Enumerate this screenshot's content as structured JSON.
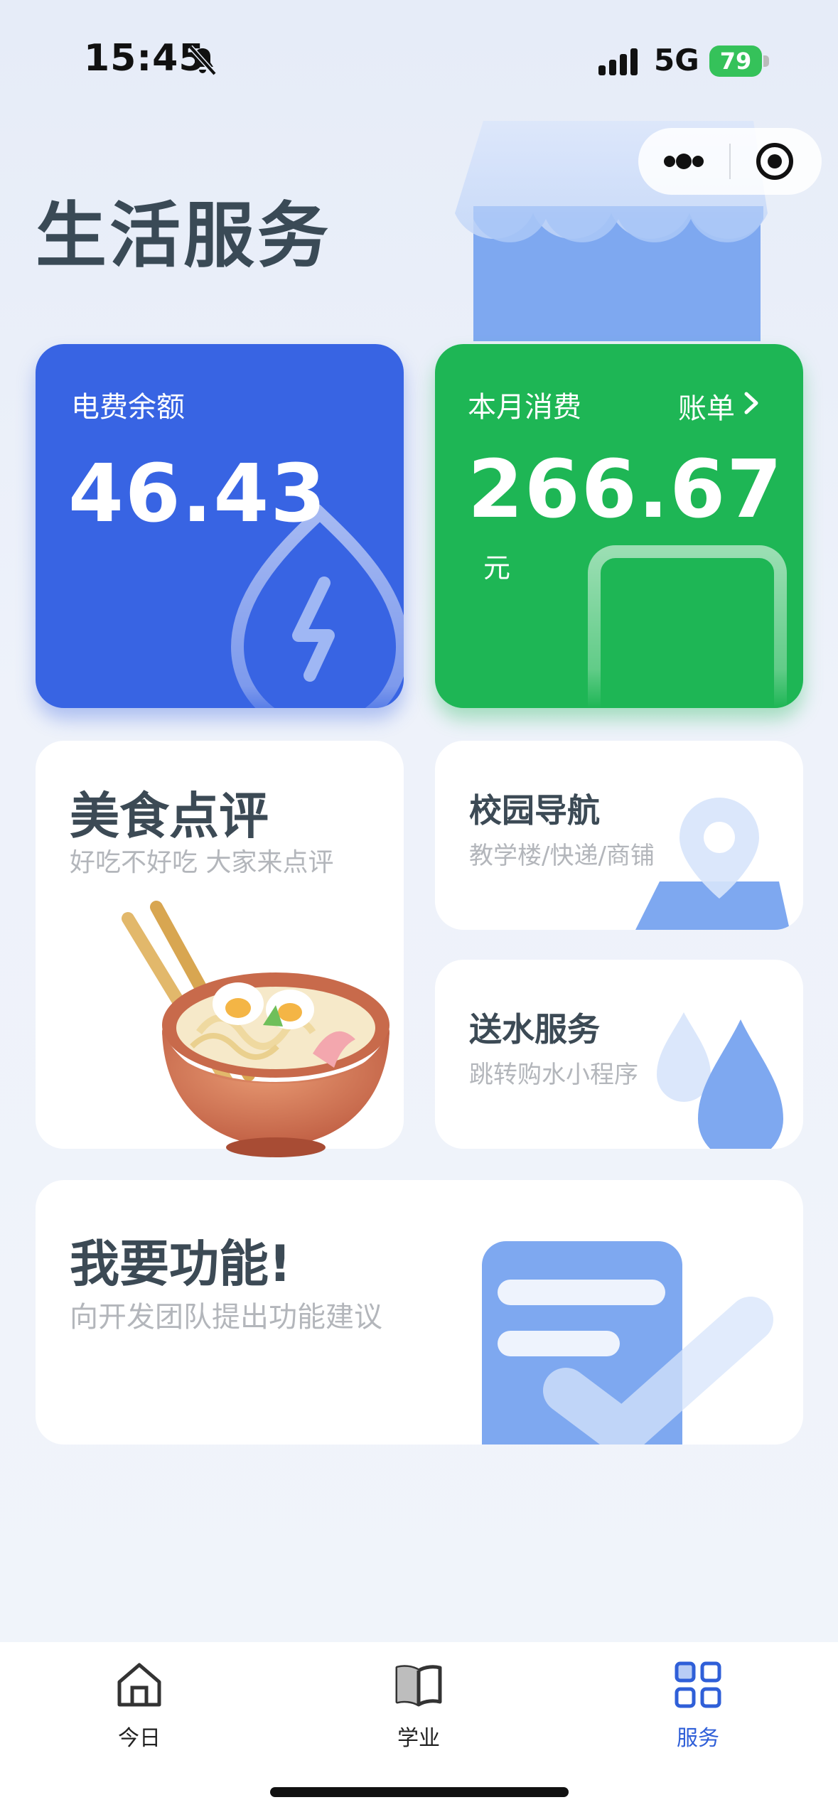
{
  "status_bar": {
    "time": "15:45",
    "network": "5G",
    "battery": "79"
  },
  "page": {
    "title": "生活服务"
  },
  "cards": {
    "electricity": {
      "label": "电费余额",
      "value": "46.43"
    },
    "monthly_spend": {
      "label": "本月消费",
      "bill_link": "账单",
      "value": "266.67",
      "unit": "元"
    },
    "food_review": {
      "title": "美食点评",
      "subtitle": "好吃不好吃 大家来点评"
    },
    "campus_nav": {
      "title": "校园导航",
      "subtitle": "教学楼/快递/商铺"
    },
    "water_delivery": {
      "title": "送水服务",
      "subtitle": "跳转购水小程序"
    },
    "feature_request": {
      "title": "我要功能!",
      "subtitle": "向开发团队提出功能建议"
    }
  },
  "tab_bar": {
    "items": [
      {
        "label": "今日",
        "icon": "home-icon",
        "active": false
      },
      {
        "label": "学业",
        "icon": "book-icon",
        "active": false
      },
      {
        "label": "服务",
        "icon": "grid-icon",
        "active": true
      }
    ]
  },
  "colors": {
    "electricity_card": "#3864e3",
    "spend_card": "#1eb655",
    "active_tab": "#2f5fd8",
    "title_text": "#3a4a56",
    "decor_blue": "#7ea8f0"
  }
}
